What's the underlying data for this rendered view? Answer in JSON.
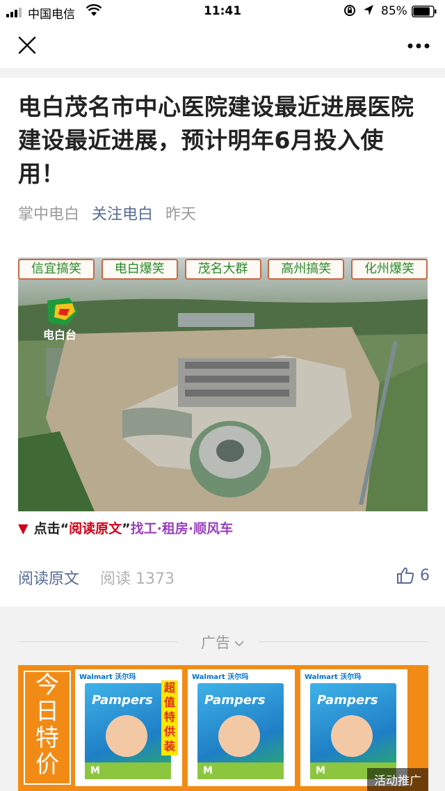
{
  "status_bar": {
    "carrier": "中国电信",
    "time": "11:41",
    "battery_percent": "85%",
    "battery_level": 0.85
  },
  "nav": {
    "close_icon": "close-icon",
    "more_icon": "more-icon"
  },
  "article": {
    "title": "电白茂名市中心医院建设最近进展医院建设最近进展，预计明年6月投入使用！",
    "source": "掌中电白",
    "account": "关注电白",
    "time": "昨天",
    "tags": [
      "信宜搞笑",
      "电白爆笑",
      "茂名大群",
      "高州搞笑",
      "化州爆笑"
    ],
    "logo_text": "电白台",
    "promo": {
      "triangle": "▼",
      "prefix": "点击",
      "open_quote": "“",
      "link": "阅读原文",
      "close_quote": "”",
      "suffix": "找工·租房·顺风车"
    },
    "read_original": "阅读原文",
    "read_label": "阅读",
    "read_count": "1373",
    "likes": "6"
  },
  "ad": {
    "label": "广告",
    "side_text": [
      "今",
      "日",
      "特",
      "价"
    ],
    "products": [
      {
        "store": "Walmart 沃尔玛",
        "brand": "Pampers",
        "size": "M",
        "sale_text": "超值特供装"
      },
      {
        "store": "Walmart 沃尔玛",
        "brand": "Pampers",
        "size": "M",
        "sale_text": ""
      },
      {
        "store": "Walmart 沃尔玛",
        "brand": "Pampers",
        "size": "M",
        "sale_text": ""
      }
    ],
    "more_label": "活动推广"
  }
}
